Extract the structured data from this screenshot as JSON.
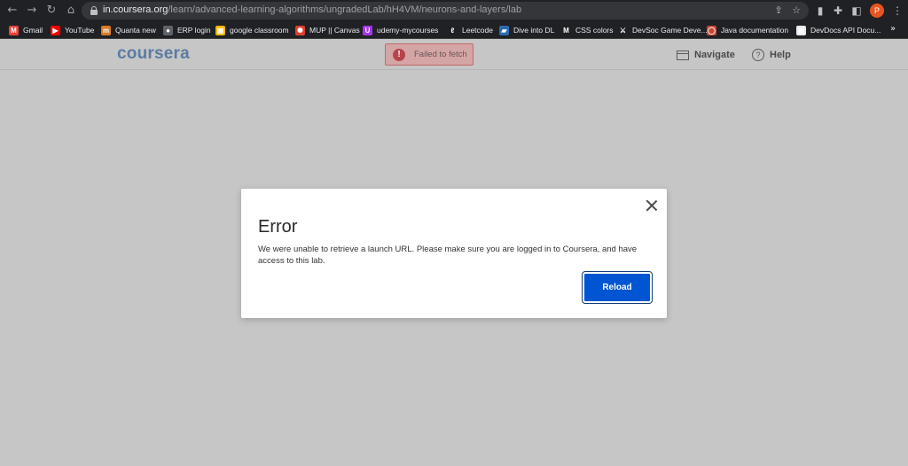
{
  "browser": {
    "url_host": "in.coursera.org",
    "url_path": "/learn/advanced-learning-algorithms/ungradedLab/hH4VM/neurons-and-layers/lab",
    "profile_initial": "P"
  },
  "bookmarks": [
    {
      "label": "Gmail",
      "icon": "gmail-icon",
      "color": "#ea4335",
      "glyph": "M"
    },
    {
      "label": "YouTube",
      "icon": "youtube-icon",
      "color": "#ff0000",
      "glyph": "▶"
    },
    {
      "label": "Quanta new",
      "icon": "quanta-icon",
      "color": "#d97a26",
      "glyph": "m"
    },
    {
      "label": "ERP login",
      "icon": "globe-icon",
      "color": "#5f6368",
      "glyph": "●"
    },
    {
      "label": "google classroom",
      "icon": "classroom-icon",
      "color": "#f4b400",
      "glyph": "▣"
    },
    {
      "label": "MUP || Canvas",
      "icon": "canvas-icon",
      "color": "#e13f2b",
      "glyph": "✺"
    },
    {
      "label": "udemy-mycourses",
      "icon": "udemy-icon",
      "color": "#a435f0",
      "glyph": "U"
    },
    {
      "label": "Leetcode",
      "icon": "leetcode-icon",
      "color": "#202124",
      "glyph": "ℓ"
    },
    {
      "label": "Dive into DL",
      "icon": "d2l-icon",
      "color": "#2b6cb0",
      "glyph": "▰"
    },
    {
      "label": "CSS colors",
      "icon": "css-icon",
      "color": "#202124",
      "glyph": "M"
    },
    {
      "label": "DevSoc Game Deve...",
      "icon": "devsoc-icon",
      "color": "#202124",
      "glyph": "⚔"
    },
    {
      "label": "Java documentation",
      "icon": "oracle-icon",
      "color": "#c74634",
      "glyph": "◯"
    },
    {
      "label": "DevDocs API Docu...",
      "icon": "devdocs-icon",
      "color": "#e8eaed",
      "glyph": "▤"
    }
  ],
  "coursera": {
    "logo": "coursera",
    "toast": "Failed to fetch",
    "navigate": "Navigate",
    "help": "Help"
  },
  "modal": {
    "title": "Error",
    "body": "We were unable to retrieve a launch URL. Please make sure you are logged in to Coursera, and have access to this lab.",
    "button": "Reload"
  },
  "colors": {
    "primary_button": "#0056d2",
    "logo": "#5b7ba3",
    "overlay": "#c6c6c6"
  }
}
